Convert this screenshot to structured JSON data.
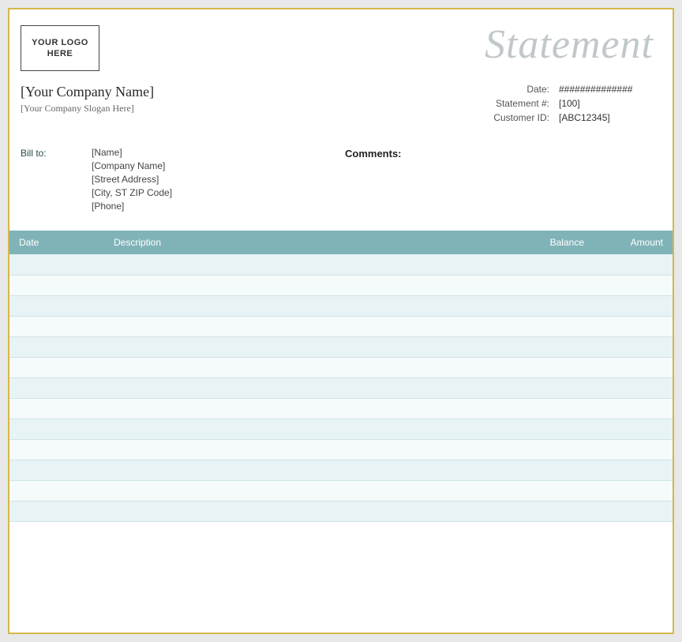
{
  "header": {
    "logo_text": "YOUR LOGO\nHERE",
    "title": "Statement"
  },
  "company": {
    "name": "[Your Company Name]",
    "slogan": "[Your Company Slogan Here]"
  },
  "meta": {
    "date_label": "Date:",
    "date_value": "##############",
    "statement_label": "Statement #:",
    "statement_value": "[100]",
    "customer_label": "Customer ID:",
    "customer_value": "[ABC12345]"
  },
  "bill_to": {
    "label": "Bill to:",
    "name": "[Name]",
    "company": "[Company Name]",
    "address": "[Street Address]",
    "city": "[City, ST  ZIP Code]",
    "phone": "[Phone]"
  },
  "comments": {
    "label": "Comments:"
  },
  "table": {
    "columns": [
      "Date",
      "Description",
      "Balance",
      "Amount"
    ],
    "rows": [
      {
        "date": "",
        "desc": "",
        "balance": "",
        "amount": ""
      },
      {
        "date": "",
        "desc": "",
        "balance": "",
        "amount": ""
      },
      {
        "date": "",
        "desc": "",
        "balance": "",
        "amount": ""
      },
      {
        "date": "",
        "desc": "",
        "balance": "",
        "amount": ""
      },
      {
        "date": "",
        "desc": "",
        "balance": "",
        "amount": ""
      },
      {
        "date": "",
        "desc": "",
        "balance": "",
        "amount": ""
      },
      {
        "date": "",
        "desc": "",
        "balance": "",
        "amount": ""
      },
      {
        "date": "",
        "desc": "",
        "balance": "",
        "amount": ""
      },
      {
        "date": "",
        "desc": "",
        "balance": "",
        "amount": ""
      },
      {
        "date": "",
        "desc": "",
        "balance": "",
        "amount": ""
      },
      {
        "date": "",
        "desc": "",
        "balance": "",
        "amount": ""
      },
      {
        "date": "",
        "desc": "",
        "balance": "",
        "amount": ""
      },
      {
        "date": "",
        "desc": "",
        "balance": "",
        "amount": ""
      }
    ]
  }
}
